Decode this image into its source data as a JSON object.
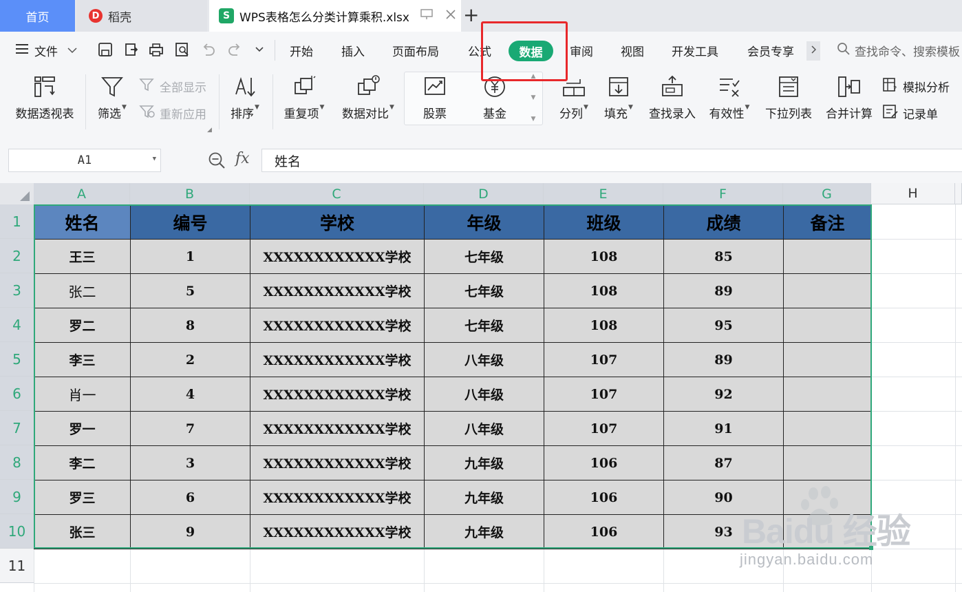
{
  "tabs": {
    "home": "首页",
    "daoke": "稻壳",
    "file": "WPS表格怎么分类计算乘积.xlsx"
  },
  "menu": {
    "file": "文件",
    "items": [
      "开始",
      "插入",
      "页面布局",
      "公式",
      "数据",
      "审阅",
      "视图",
      "开发工具",
      "会员专享"
    ],
    "active": "数据",
    "search": "查找命令、搜索模板"
  },
  "ribbon": {
    "pivot": "数据透视表",
    "filter": "筛选",
    "show_all": "全部显示",
    "reapply": "重新应用",
    "sort": "排序",
    "duplicates": "重复项",
    "compare": "数据对比",
    "stock": "股票",
    "fund": "基金",
    "split": "分列",
    "fill": "填充",
    "lookup": "查找录入",
    "validity": "有效性",
    "dropdown": "下拉列表",
    "consolidate": "合并计算",
    "whatif": "模拟分析",
    "record": "记录单"
  },
  "formula_bar": {
    "cell_ref": "A1",
    "fx": "fx",
    "content": "姓名"
  },
  "sheet": {
    "columns": [
      "A",
      "B",
      "C",
      "D",
      "E",
      "F",
      "G",
      "H"
    ],
    "rows": [
      "1",
      "2",
      "3",
      "4",
      "5",
      "6",
      "7",
      "8",
      "9",
      "10",
      "11"
    ],
    "header": [
      "姓名",
      "编号",
      "学校",
      "年级",
      "班级",
      "成绩",
      "备注"
    ],
    "data": [
      [
        "王三",
        "1",
        "XXXXXXXXXXXX学校",
        "七年级",
        "108",
        "85",
        ""
      ],
      [
        "张二",
        "5",
        "XXXXXXXXXXXX学校",
        "七年级",
        "108",
        "89",
        ""
      ],
      [
        "罗二",
        "8",
        "XXXXXXXXXXXX学校",
        "七年级",
        "108",
        "95",
        ""
      ],
      [
        "李三",
        "2",
        "XXXXXXXXXXXX学校",
        "八年级",
        "107",
        "89",
        ""
      ],
      [
        "肖一",
        "4",
        "XXXXXXXXXXXX学校",
        "八年级",
        "107",
        "92",
        ""
      ],
      [
        "罗一",
        "7",
        "XXXXXXXXXXXX学校",
        "八年级",
        "107",
        "91",
        ""
      ],
      [
        "李二",
        "3",
        "XXXXXXXXXXXX学校",
        "九年级",
        "106",
        "87",
        ""
      ],
      [
        "罗三",
        "6",
        "XXXXXXXXXXXX学校",
        "九年级",
        "106",
        "90",
        ""
      ],
      [
        "张三",
        "9",
        "XXXXXXXXXXXX学校",
        "九年级",
        "106",
        "93",
        ""
      ]
    ]
  },
  "watermark": {
    "brand": "Bai",
    "brand_cn": "经验",
    "url": "jingyan.baidu.com"
  },
  "colors": {
    "accent": "#19a974",
    "highlight_box": "#e8282b",
    "header_fill": "#3a69a3",
    "body_fill": "#d9d9d9"
  }
}
